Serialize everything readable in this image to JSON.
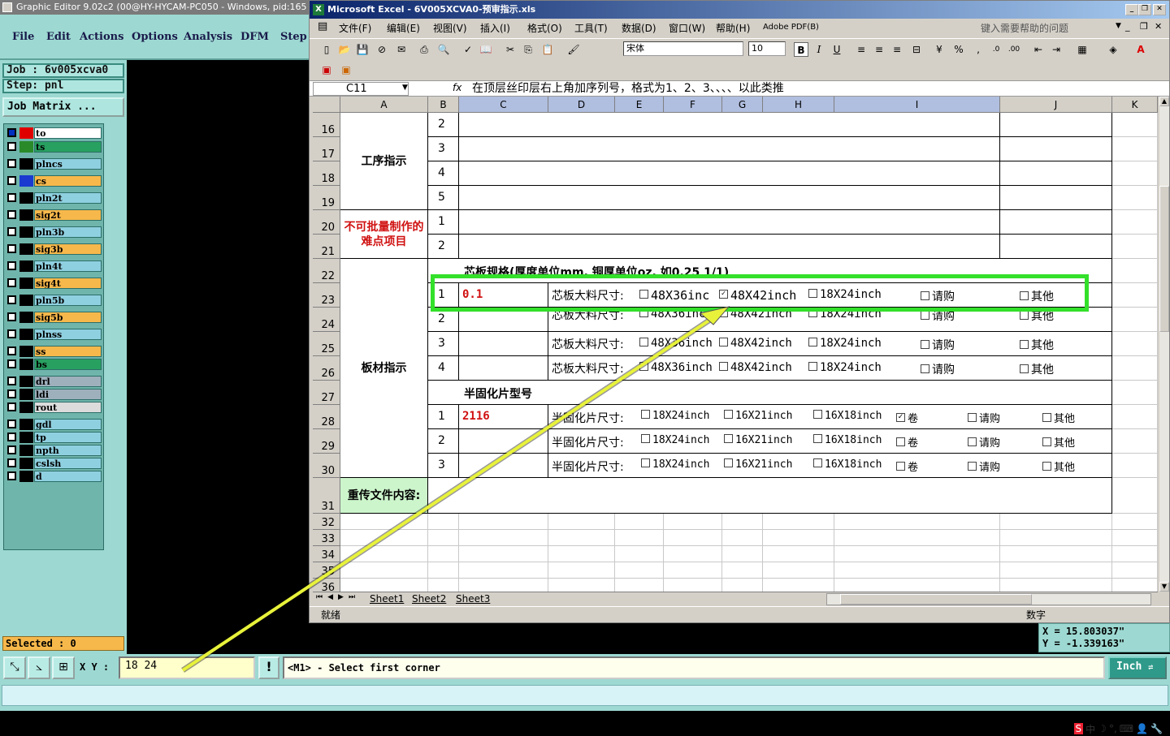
{
  "ge": {
    "title": "Graphic Editor 9.02c2 (00@HY-HYCAM-PC050 - Windows, pid:165",
    "menu": [
      "File",
      "Edit",
      "Actions",
      "Options",
      "Analysis",
      "DFM",
      "Step"
    ],
    "job": "Job  : 6v005xcva0",
    "step": "Step: pnl",
    "job_matrix": "Job Matrix ...",
    "layers": [
      {
        "name": "to",
        "color": "#ffffff",
        "swatch": "#e00000",
        "box": "#0030c0"
      },
      {
        "name": "ts",
        "color": "#28a060",
        "swatch": "#2a8a2a",
        "box": "#ffffff"
      },
      {
        "name": "plncs",
        "color": "#8fd0e0",
        "swatch": "#000000",
        "box": "#ffffff"
      },
      {
        "name": "cs",
        "color": "#f7b84b",
        "swatch": "#1a3ad0",
        "box": "#ffffff"
      },
      {
        "name": "pln2t",
        "color": "#8fd0e0",
        "swatch": "#000000",
        "box": "#ffffff"
      },
      {
        "name": "sig2t",
        "color": "#f7b84b",
        "swatch": "#000000",
        "box": "#ffffff"
      },
      {
        "name": "pln3b",
        "color": "#8fd0e0",
        "swatch": "#000000",
        "box": "#ffffff"
      },
      {
        "name": "sig3b",
        "color": "#f7b84b",
        "swatch": "#000000",
        "box": "#ffffff"
      },
      {
        "name": "pln4t",
        "color": "#8fd0e0",
        "swatch": "#000000",
        "box": "#ffffff"
      },
      {
        "name": "sig4t",
        "color": "#f7b84b",
        "swatch": "#000000",
        "box": "#ffffff"
      },
      {
        "name": "pln5b",
        "color": "#8fd0e0",
        "swatch": "#000000",
        "box": "#ffffff"
      },
      {
        "name": "sig5b",
        "color": "#f7b84b",
        "swatch": "#000000",
        "box": "#ffffff"
      },
      {
        "name": "plnss",
        "color": "#8fd0e0",
        "swatch": "#000000",
        "box": "#ffffff"
      },
      {
        "name": "ss",
        "color": "#f7b84b",
        "swatch": "#000000",
        "box": "#ffffff"
      },
      {
        "name": "bs",
        "color": "#28a060",
        "swatch": "#000000",
        "box": "#ffffff"
      },
      {
        "name": "drl",
        "color": "#9fb0bd",
        "swatch": "#000000",
        "box": "#ffffff"
      },
      {
        "name": "ldi",
        "color": "#9fb0bd",
        "swatch": "#000000",
        "box": "#ffffff"
      },
      {
        "name": "rout",
        "color": "#dcdcdc",
        "swatch": "#000000",
        "box": "#ffffff"
      },
      {
        "name": "gdl",
        "color": "#8fd0e0",
        "swatch": "#000000",
        "box": "#ffffff"
      },
      {
        "name": "tp",
        "color": "#8fd0e0",
        "swatch": "#000000",
        "box": "#ffffff"
      },
      {
        "name": "npth",
        "color": "#8fd0e0",
        "swatch": "#000000",
        "box": "#ffffff"
      },
      {
        "name": "cslsh",
        "color": "#8fd0e0",
        "swatch": "#000000",
        "box": "#ffffff"
      },
      {
        "name": "d",
        "color": "#8fd0e0",
        "swatch": "#000000",
        "box": "#ffffff"
      }
    ],
    "selected": "Selected : 0",
    "xy_label": "X Y :",
    "xy_value": "18 24",
    "excl": "!",
    "prompt": "<M1> - Select first corner",
    "unit": "Inch",
    "coord_x": "X  =  15.803037\"",
    "coord_y": "Y  =  -1.339163\""
  },
  "xl": {
    "title": "Microsoft Excel - 6V005XCVA0-预审指示.xls",
    "menu": [
      "文件(F)",
      "编辑(E)",
      "视图(V)",
      "插入(I)",
      "格式(O)",
      "工具(T)",
      "数据(D)",
      "窗口(W)",
      "帮助(H)",
      "Adobe PDF(B)"
    ],
    "help_placeholder": "键入需要帮助的问题",
    "font": "宋体",
    "size": "10",
    "name_box": "C11",
    "fx": "fx",
    "formula": "在顶层丝印层右上角加序列号，格式为1、2、3、、、、以此类推",
    "columns": [
      "A",
      "B",
      "C",
      "D",
      "E",
      "F",
      "G",
      "H",
      "I",
      "J",
      "K"
    ],
    "rows": [
      "16",
      "17",
      "18",
      "19",
      "20",
      "21",
      "22",
      "23",
      "24",
      "25",
      "26",
      "27",
      "28",
      "29",
      "30",
      "31",
      "32",
      "33",
      "34",
      "35",
      "36"
    ],
    "labels": {
      "gongxu": "工序指示",
      "nandian": "不可批量制作的难点项目",
      "bancai": "板材指示",
      "chongchuan": "重传文件内容:"
    },
    "seq": [
      "2",
      "3",
      "4",
      "5",
      "1",
      "2"
    ],
    "core_header": "芯板规格(厚度单位mm, 铜厚单位oz, 如0.25 1/1)",
    "core_rows": [
      {
        "n": "1",
        "c": "0.1",
        "label": "芯板大料尺寸:",
        "o1": "48X36inc",
        "o2": "48X42inch",
        "o3": "18X24inch",
        "o4": "请购",
        "o5": "其他",
        "checked": 2
      },
      {
        "n": "2",
        "c": "",
        "label": "芯板大料尺寸:",
        "o1": "48X36inc",
        "o2": "48X42inch",
        "o3": "18X24inch",
        "o4": "请购",
        "o5": "其他",
        "checked": 0
      },
      {
        "n": "3",
        "c": "",
        "label": "芯板大料尺寸:",
        "o1": "48X36inch",
        "o2": "48X42inch",
        "o3": "18X24inch",
        "o4": "请购",
        "o5": "其他",
        "checked": 0
      },
      {
        "n": "4",
        "c": "",
        "label": "芯板大料尺寸:",
        "o1": "48X36inch",
        "o2": "48X42inch",
        "o3": "18X24inch",
        "o4": "请购",
        "o5": "其他",
        "checked": 0
      }
    ],
    "pp_header": "半固化片型号",
    "pp_rows": [
      {
        "n": "1",
        "c": "2116",
        "label": "半固化片尺寸:",
        "o1": "18X24inch",
        "o2": "16X21inch",
        "o3": "16X18inch",
        "o4": "卷",
        "o5": "请购",
        "o6": "其他",
        "checked": 4
      },
      {
        "n": "2",
        "c": "",
        "label": "半固化片尺寸:",
        "o1": "18X24inch",
        "o2": "16X21inch",
        "o3": "16X18inch",
        "o4": "卷",
        "o5": "请购",
        "o6": "其他",
        "checked": 0
      },
      {
        "n": "3",
        "c": "",
        "label": "半固化片尺寸:",
        "o1": "18X24inch",
        "o2": "16X21inch",
        "o3": "16X18inch",
        "o4": "卷",
        "o5": "请购",
        "o6": "其他",
        "checked": 0
      }
    ],
    "sheets": [
      "Sheet1",
      "Sheet2",
      "Sheet3"
    ],
    "status_left": "就绪",
    "status_right": "数字"
  },
  "ime": [
    "S",
    "中",
    "☽",
    "°,",
    "⌨",
    "👤",
    "🔧"
  ],
  "colors": {
    "highlight": "#33e02a",
    "arrow": "#e8f23a",
    "teal": "#9dd9d2",
    "red_text": "#d01010"
  }
}
